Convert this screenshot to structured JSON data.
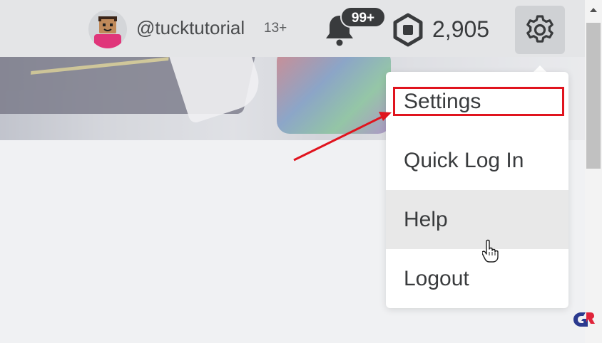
{
  "header": {
    "username": "@tucktutorial",
    "age_badge": "13+",
    "notifications_count": "99+",
    "robux_amount": "2,905"
  },
  "settings_menu": {
    "items": [
      {
        "label": "Settings"
      },
      {
        "label": "Quick Log In"
      },
      {
        "label": "Help"
      },
      {
        "label": "Logout"
      }
    ]
  },
  "icons": [
    "avatar",
    "bell-icon",
    "robux-icon",
    "gear-icon",
    "hand-cursor-icon"
  ],
  "colors": {
    "highlight": "#e0141e",
    "badge": "#393b3d",
    "hover": "#e8e8e8"
  }
}
